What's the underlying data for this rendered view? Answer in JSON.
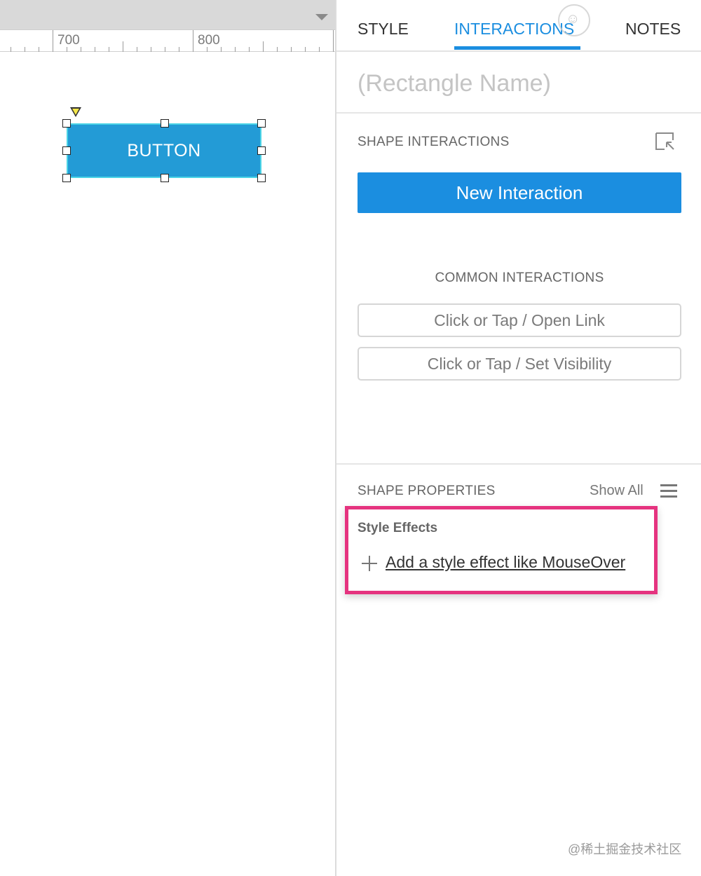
{
  "canvas": {
    "ruler": {
      "labels": [
        "700",
        "800"
      ]
    },
    "selected_shape": {
      "label": "BUTTON",
      "fill": "#239bd6",
      "border": "#4ad3e6"
    }
  },
  "inspector": {
    "tabs": [
      {
        "label": "STYLE",
        "active": false
      },
      {
        "label": "INTERACTIONS",
        "active": true
      },
      {
        "label": "NOTES",
        "active": false
      }
    ],
    "accent_color": "#1b8ee0",
    "name_placeholder": "(Rectangle Name)",
    "shape_interactions": {
      "title": "SHAPE INTERACTIONS",
      "new_interaction_label": "New Interaction"
    },
    "common_interactions": {
      "title": "COMMON INTERACTIONS",
      "items": [
        "Click or Tap / Open Link",
        "Click or Tap / Set Visibility"
      ]
    },
    "shape_properties": {
      "title": "SHAPE PROPERTIES",
      "show_all_label": "Show All",
      "style_effects_title": "Style Effects",
      "add_effect_label": "Add a style effect like MouseOver",
      "highlight_color": "#e5337f"
    }
  },
  "watermark": {
    "footer": "@稀土掘金技术社区"
  }
}
